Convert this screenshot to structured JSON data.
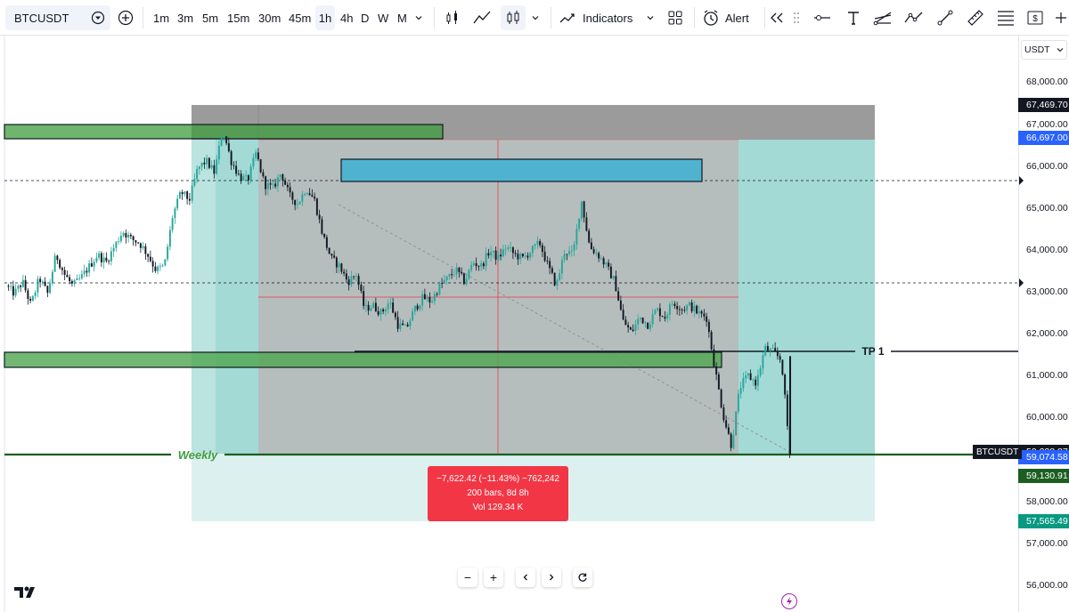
{
  "toolbar": {
    "symbol": "BTCUSDT",
    "timeframes": [
      "1m",
      "3m",
      "5m",
      "15m",
      "30m",
      "45m",
      "1h",
      "4h",
      "D",
      "W",
      "M"
    ],
    "active_timeframe": "1h",
    "indicators_label": "Indicators",
    "alert_label": "Alert"
  },
  "price_scale": {
    "currency": "USDT",
    "ticks": [
      "68,000.00",
      "67,000.00",
      "66,000.00",
      "65,000.00",
      "64,000.00",
      "63,000.00",
      "62,000.00",
      "61,000.00",
      "60,000.00",
      "58,000.00",
      "57,000.00",
      "56,000.00"
    ],
    "tags": {
      "top": "67,469.70",
      "upper": "66,697.00",
      "current": "59,074.58",
      "current_hidden": "59,228.87",
      "lower": "59,130.91",
      "bottom": "57,565.49"
    },
    "symbol_tag": "BTCUSDT"
  },
  "drawings": {
    "tp_label": "TP 1",
    "weekly_label": "Weekly"
  },
  "measure": {
    "line1": "−7,622.42 (−11.43%) −762,242",
    "line2": "200 bars, 8d 8h",
    "line3": "Vol 129.34 K"
  },
  "colors": {
    "up": "#26a69a",
    "down": "#131722",
    "tag_blue": "#2962ff",
    "tag_green": "#1b5e20",
    "tag_teal": "#089981",
    "measure_red": "#f23645"
  },
  "chart_data": {
    "type": "candlestick",
    "symbol": "BTCUSDT",
    "interval": "1h",
    "ylim": [
      55800,
      68600
    ],
    "close_path": [
      63400,
      63200,
      63500,
      62900,
      63600,
      63200,
      64200,
      63700,
      63400,
      63600,
      63900,
      64200,
      64000,
      64400,
      64800,
      64600,
      64500,
      64200,
      63800,
      63900,
      65200,
      65800,
      65600,
      66400,
      66600,
      66300,
      67400,
      66600,
      66200,
      66100,
      66800,
      66000,
      65900,
      66300,
      65700,
      65500,
      65900,
      65600,
      64700,
      64100,
      63900,
      63500,
      63700,
      62800,
      62900,
      62700,
      63000,
      62400,
      62300,
      62800,
      63100,
      63000,
      63400,
      63600,
      63800,
      63500,
      64000,
      63900,
      64300,
      64100,
      64400,
      64200,
      64100,
      64300,
      64500,
      63900,
      63400,
      64300,
      64200,
      65600,
      64400,
      64200,
      63900,
      63500,
      62500,
      62200,
      62600,
      62400,
      62800,
      62600,
      63000,
      62800,
      62900,
      62700,
      62600,
      61300,
      60100,
      59300,
      60800,
      61100,
      60900,
      61800,
      61700,
      61500,
      59100
    ]
  }
}
